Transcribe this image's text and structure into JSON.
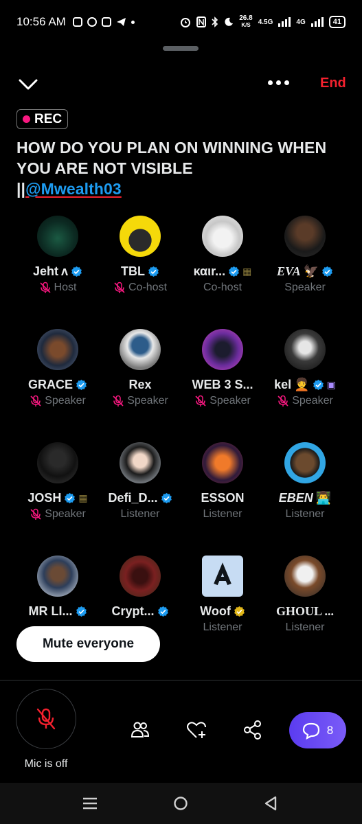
{
  "status_bar": {
    "time": "10:56 AM",
    "speed_value": "26.8",
    "speed_unit": "K/S",
    "net1": "4.5G",
    "net2": "4G",
    "battery": "41"
  },
  "header": {
    "end_label": "End",
    "rec_label": "REC"
  },
  "space": {
    "title_line": "HOW DO YOU PLAN ON WINNING WHEN YOU ARE NOT VISIBLE",
    "title_separator": "||",
    "mention": "@Mwealth03"
  },
  "participants": [
    {
      "name": "Jeht",
      "suffix": "ʌ",
      "verified": true,
      "verified_color": "#1d9bf0",
      "extra": "",
      "role": "Host",
      "muted": true,
      "avatar": "jeht"
    },
    {
      "name": "TBL",
      "suffix": "",
      "verified": true,
      "verified_color": "#1d9bf0",
      "extra": "",
      "role": "Co-host",
      "muted": true,
      "avatar": "tbl"
    },
    {
      "name": "καιr...",
      "suffix": "",
      "verified": true,
      "verified_color": "#1d9bf0",
      "extra": "▦",
      "role": "Co-host",
      "muted": false,
      "avatar": "kair"
    },
    {
      "name": "EVA",
      "suffix": "🦅",
      "verified": true,
      "verified_color": "#1d9bf0",
      "extra": "",
      "role": "Speaker",
      "muted": false,
      "avatar": "eva"
    },
    {
      "name": "GRACE",
      "suffix": "",
      "verified": true,
      "verified_color": "#1d9bf0",
      "extra": "",
      "role": "Speaker",
      "muted": true,
      "avatar": "grace"
    },
    {
      "name": "Rex",
      "suffix": "",
      "verified": false,
      "verified_color": "#1d9bf0",
      "extra": "",
      "role": "Speaker",
      "muted": true,
      "avatar": "rex"
    },
    {
      "name": "WEB 3 S...",
      "suffix": "",
      "verified": false,
      "verified_color": "#1d9bf0",
      "extra": "",
      "role": "Speaker",
      "muted": true,
      "avatar": "web3"
    },
    {
      "name": "kel",
      "suffix": "🧑‍🦱",
      "verified": true,
      "verified_color": "#1d9bf0",
      "extra": "▣",
      "role": "Speaker",
      "muted": true,
      "avatar": "kel"
    },
    {
      "name": "JOSH",
      "suffix": "",
      "verified": true,
      "verified_color": "#1d9bf0",
      "extra": "▦",
      "role": "Speaker",
      "muted": true,
      "avatar": "josh"
    },
    {
      "name": "Defi_D...",
      "suffix": "",
      "verified": true,
      "verified_color": "#1d9bf0",
      "extra": "",
      "role": "Listener",
      "muted": false,
      "avatar": "defi"
    },
    {
      "name": "ESSON",
      "suffix": "",
      "verified": false,
      "verified_color": "#1d9bf0",
      "extra": "",
      "role": "Listener",
      "muted": false,
      "avatar": "esson"
    },
    {
      "name": "EBEN",
      "suffix": "👨‍💻",
      "verified": false,
      "verified_color": "#1d9bf0",
      "extra": "",
      "role": "Listener",
      "muted": false,
      "avatar": "eben"
    },
    {
      "name": "MR LI...",
      "suffix": "",
      "verified": true,
      "verified_color": "#1d9bf0",
      "extra": "",
      "role": "",
      "muted": false,
      "avatar": "mrli"
    },
    {
      "name": "Crypt...",
      "suffix": "",
      "verified": true,
      "verified_color": "#1d9bf0",
      "extra": "",
      "role": "",
      "muted": false,
      "avatar": "crypt"
    },
    {
      "name": "Woof",
      "suffix": "",
      "verified": true,
      "verified_color": "#e2b719",
      "extra": "",
      "role": "Listener",
      "muted": false,
      "avatar": "woof"
    },
    {
      "name": "GHOUL ...",
      "suffix": "",
      "verified": false,
      "verified_color": "#1d9bf0",
      "extra": "",
      "role": "Listener",
      "muted": false,
      "avatar": "ghoul"
    }
  ],
  "controls": {
    "mute_everyone": "Mute everyone",
    "mic_status": "Mic is off",
    "chat_count": "8"
  },
  "colors": {
    "accent_blue": "#1d9bf0",
    "end_red": "#f4212e",
    "rec_pink": "#f91880",
    "chat_purple": "#6a4cf4"
  }
}
